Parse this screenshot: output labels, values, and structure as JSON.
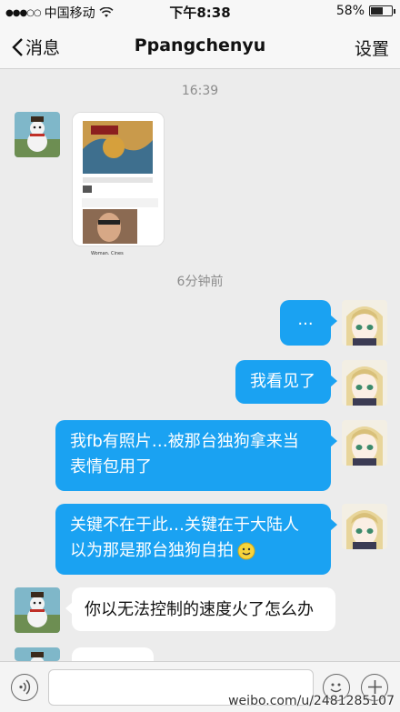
{
  "status_bar": {
    "carrier": "中国移动",
    "time": "下午8:38",
    "battery": "58%",
    "battery_level": 0.58
  },
  "nav": {
    "back_label": "消息",
    "title": "Ppangchenyu",
    "settings_label": "设置"
  },
  "chat": {
    "timestamp_1": "16:39",
    "timestamp_2": "6分钟前",
    "image_caption_name": "Woman. Cines",
    "messages": [
      {
        "side": "out",
        "text": "..."
      },
      {
        "side": "out",
        "text": "我看见了"
      },
      {
        "side": "out",
        "text_line1": "我fb有照片…被那台独狗拿来当",
        "text_line2": "表情包用了"
      },
      {
        "side": "out",
        "text_line1": "关键不在于此…关键在于大陆人",
        "text_line2": "以为那是那台独狗自拍"
      },
      {
        "side": "in",
        "text": "你以无法控制的速度火了怎么办"
      }
    ]
  },
  "watermark": "weibo.com/u/2481285107",
  "icons": [
    "back-chevron-icon",
    "wifi-icon",
    "voice-icon",
    "emoji-icon",
    "plus-icon"
  ]
}
